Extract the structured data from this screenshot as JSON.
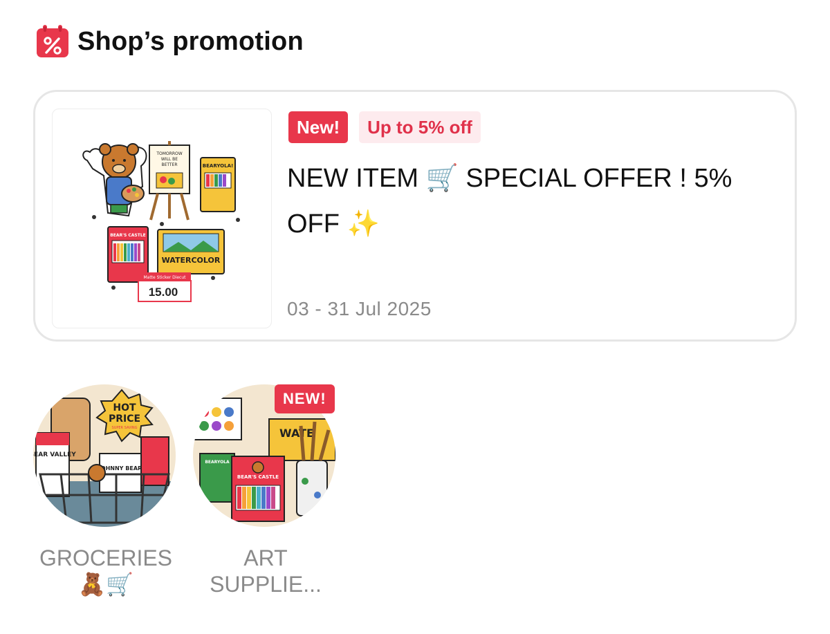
{
  "header": {
    "title": "Shop’s promotion",
    "icon": "percent-calendar-icon"
  },
  "promotion": {
    "tag_new": "New!",
    "tag_discount": "Up to 5% off",
    "headline": "NEW ITEM 🛒 SPECIAL OFFER ! 5% OFF ✨",
    "dates": "03 - 31 Jul 2025",
    "thumbnail": {
      "easel_text": "TOMORROW WILL BE BETTER",
      "box_brand": "BEARYOLA!",
      "box2_label": "BEAR'S CASTLE",
      "watercolor_label": "WATERCOLOR",
      "price_caption": "Matte Sticker Diecut",
      "price": "15.00"
    }
  },
  "categories": [
    {
      "label_line1": "GROCERIES",
      "label_line2": "🧸🛒",
      "badge": "",
      "art": {
        "burst_line1": "HOT",
        "burst_line2": "PRICE",
        "burst_line3": "SUPER SAVING",
        "sign": "BEAR VALLEY",
        "sign2": "JOHNNY BEAR"
      }
    },
    {
      "label_line1": "ART",
      "label_line2": "SUPPLIE...",
      "badge": "NEW!",
      "art": {
        "brand": "BEARYOLA",
        "box_label": "BEAR'S CASTLE",
        "sign": "WATE"
      }
    }
  ],
  "colors": {
    "accent": "#e8374b",
    "accent_light": "#fdebee",
    "muted_text": "#8a8a8a",
    "card_border": "#e6e6e6"
  }
}
